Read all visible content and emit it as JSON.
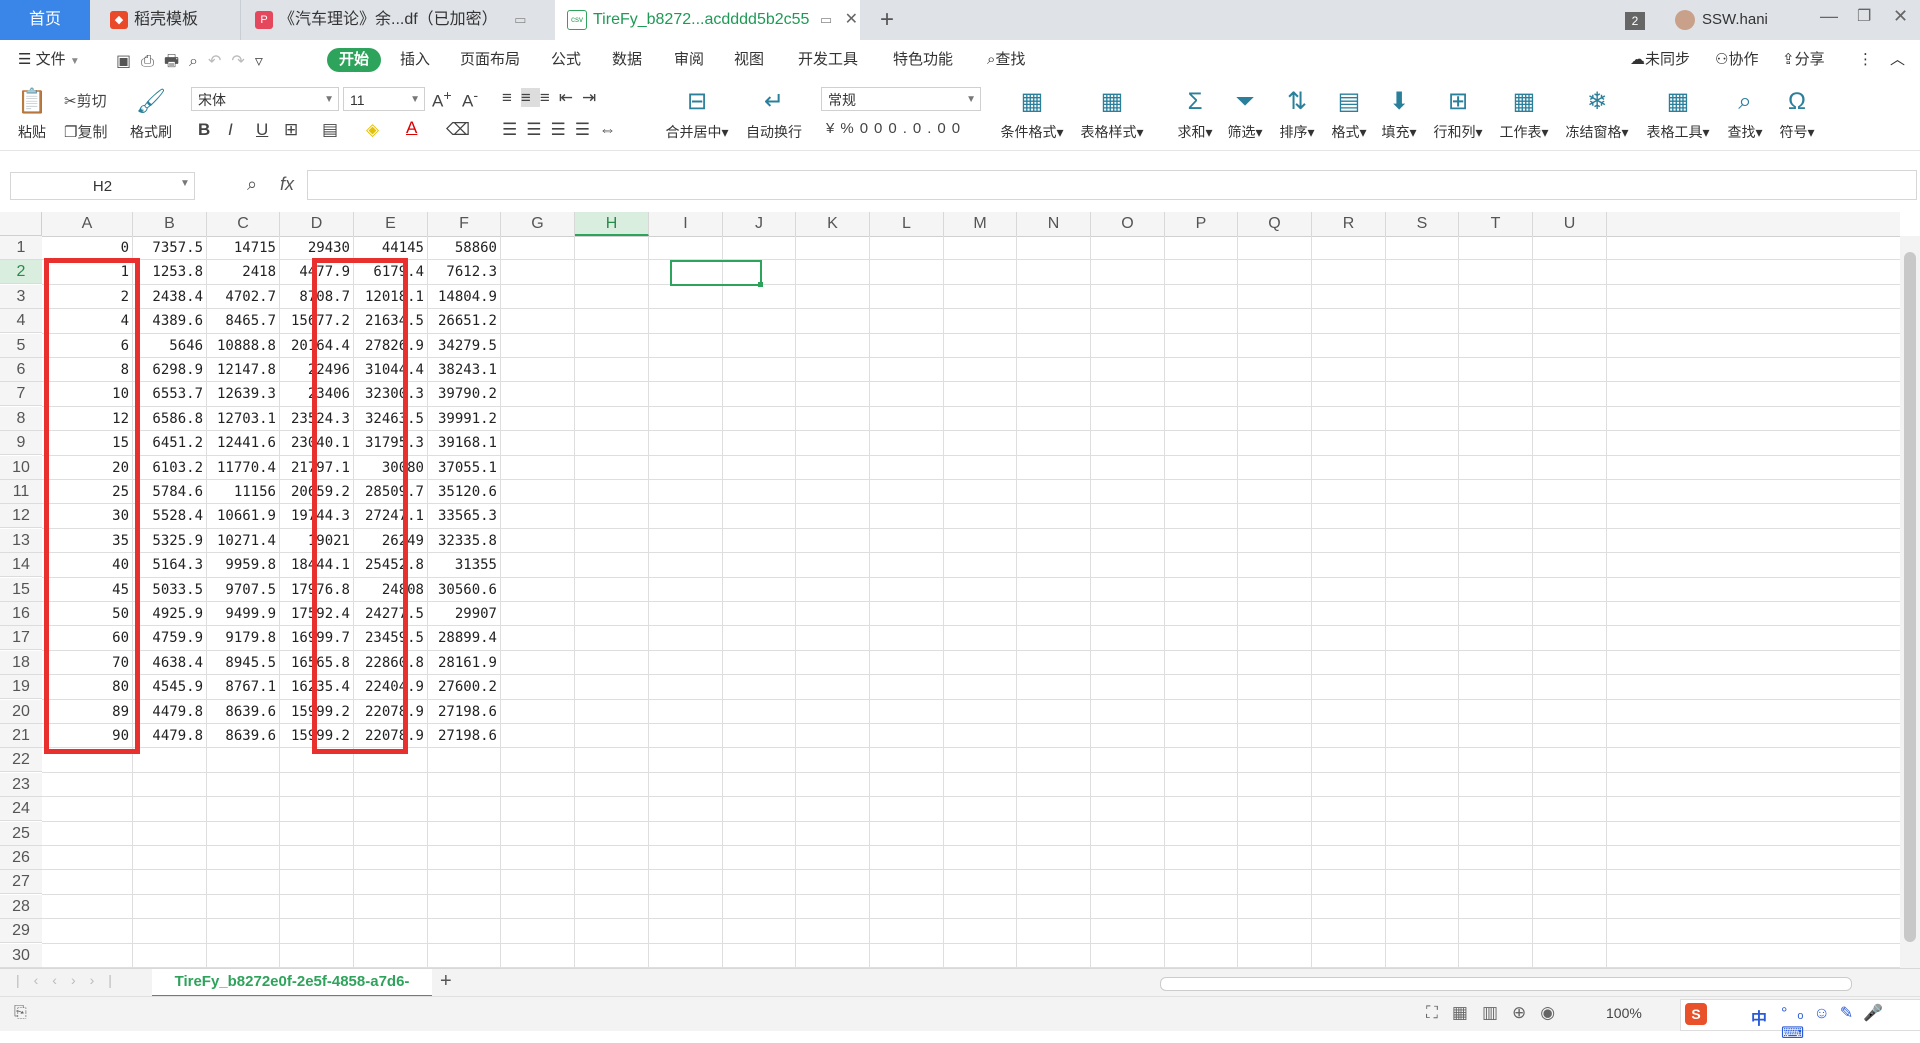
{
  "tabs": {
    "home": "首页",
    "template": "稻壳模板",
    "pdf": "《汽车理论》余...df（已加密）",
    "csv": "TireFy_b8272...acdddd5b2c55",
    "new_tab": "+",
    "badge": "2",
    "user": "SSW.hani"
  },
  "menubar": {
    "file": "文件",
    "items": [
      "开始",
      "插入",
      "页面布局",
      "公式",
      "数据",
      "审阅",
      "视图",
      "开发工具",
      "特色功能"
    ],
    "search": "查找",
    "sync": "未同步",
    "collab": "协作",
    "share": "分享"
  },
  "ribbon": {
    "paste": "粘贴",
    "cut": "剪切",
    "copy": "复制",
    "format_painter": "格式刷",
    "font_name": "宋体",
    "font_size": "11",
    "merge_center": "合并居中",
    "wrap": "自动换行",
    "number_format": "常规",
    "cond_format": "条件格式",
    "table_style": "表格样式",
    "sum": "求和",
    "filter": "筛选",
    "sort": "排序",
    "format": "格式",
    "fill": "填充",
    "row_col": "行和列",
    "worksheet": "工作表",
    "freeze": "冻结窗格",
    "table_tools": "表格工具",
    "find": "查找",
    "symbol": "符号"
  },
  "formula_bar": {
    "cell_ref": "H2",
    "fx": "fx",
    "value": ""
  },
  "columns": [
    "A",
    "B",
    "C",
    "D",
    "E",
    "F",
    "G",
    "H",
    "I",
    "J",
    "K",
    "L",
    "M",
    "N",
    "O",
    "P",
    "Q",
    "R",
    "S",
    "T",
    "U"
  ],
  "active_column": "H",
  "active_row": 2,
  "rows": [
    [
      "0",
      "7357.5",
      "14715",
      "29430",
      "44145",
      "58860"
    ],
    [
      "1",
      "1253.8",
      "2418",
      "4477.9",
      "6179.4",
      "7612.3"
    ],
    [
      "2",
      "2438.4",
      "4702.7",
      "8708.7",
      "12018.1",
      "14804.9"
    ],
    [
      "4",
      "4389.6",
      "8465.7",
      "15677.2",
      "21634.5",
      "26651.2"
    ],
    [
      "6",
      "5646",
      "10888.8",
      "20164.4",
      "27826.9",
      "34279.5"
    ],
    [
      "8",
      "6298.9",
      "12147.8",
      "22496",
      "31044.4",
      "38243.1"
    ],
    [
      "10",
      "6553.7",
      "12639.3",
      "23406",
      "32300.3",
      "39790.2"
    ],
    [
      "12",
      "6586.8",
      "12703.1",
      "23524.3",
      "32463.5",
      "39991.2"
    ],
    [
      "15",
      "6451.2",
      "12441.6",
      "23040.1",
      "31795.3",
      "39168.1"
    ],
    [
      "20",
      "6103.2",
      "11770.4",
      "21797.1",
      "30080",
      "37055.1"
    ],
    [
      "25",
      "5784.6",
      "11156",
      "20659.2",
      "28509.7",
      "35120.6"
    ],
    [
      "30",
      "5528.4",
      "10661.9",
      "19744.3",
      "27247.1",
      "33565.3"
    ],
    [
      "35",
      "5325.9",
      "10271.4",
      "19021",
      "26249",
      "32335.8"
    ],
    [
      "40",
      "5164.3",
      "9959.8",
      "18444.1",
      "25452.8",
      "31355"
    ],
    [
      "45",
      "5033.5",
      "9707.5",
      "17976.8",
      "24808",
      "30560.6"
    ],
    [
      "50",
      "4925.9",
      "9499.9",
      "17592.4",
      "24277.5",
      "29907"
    ],
    [
      "60",
      "4759.9",
      "9179.8",
      "16999.7",
      "23459.5",
      "28899.4"
    ],
    [
      "70",
      "4638.4",
      "8945.5",
      "16565.8",
      "22860.8",
      "28161.9"
    ],
    [
      "80",
      "4545.9",
      "8767.1",
      "16235.4",
      "22404.9",
      "27600.2"
    ],
    [
      "89",
      "4479.8",
      "8639.6",
      "15999.2",
      "22078.9",
      "27198.6"
    ],
    [
      "90",
      "4479.8",
      "8639.6",
      "15999.2",
      "22078.9",
      "27198.6"
    ]
  ],
  "row_numbers": [
    "1",
    "2",
    "3",
    "4",
    "5",
    "6",
    "7",
    "8",
    "9",
    "10",
    "11",
    "12",
    "13",
    "14",
    "15",
    "16",
    "17",
    "18",
    "19",
    "20",
    "21",
    "22",
    "23",
    "24",
    "25",
    "26",
    "27",
    "28",
    "29",
    "30"
  ],
  "sheet_tab": "TireFy_b8272e0f-2e5f-4858-a7d6-",
  "status": {
    "zoom": "100%",
    "ime": "中"
  },
  "colors": {
    "accent": "#2ea35b",
    "highlight_box": "#e8312f",
    "home_tab": "#3a86e8"
  }
}
